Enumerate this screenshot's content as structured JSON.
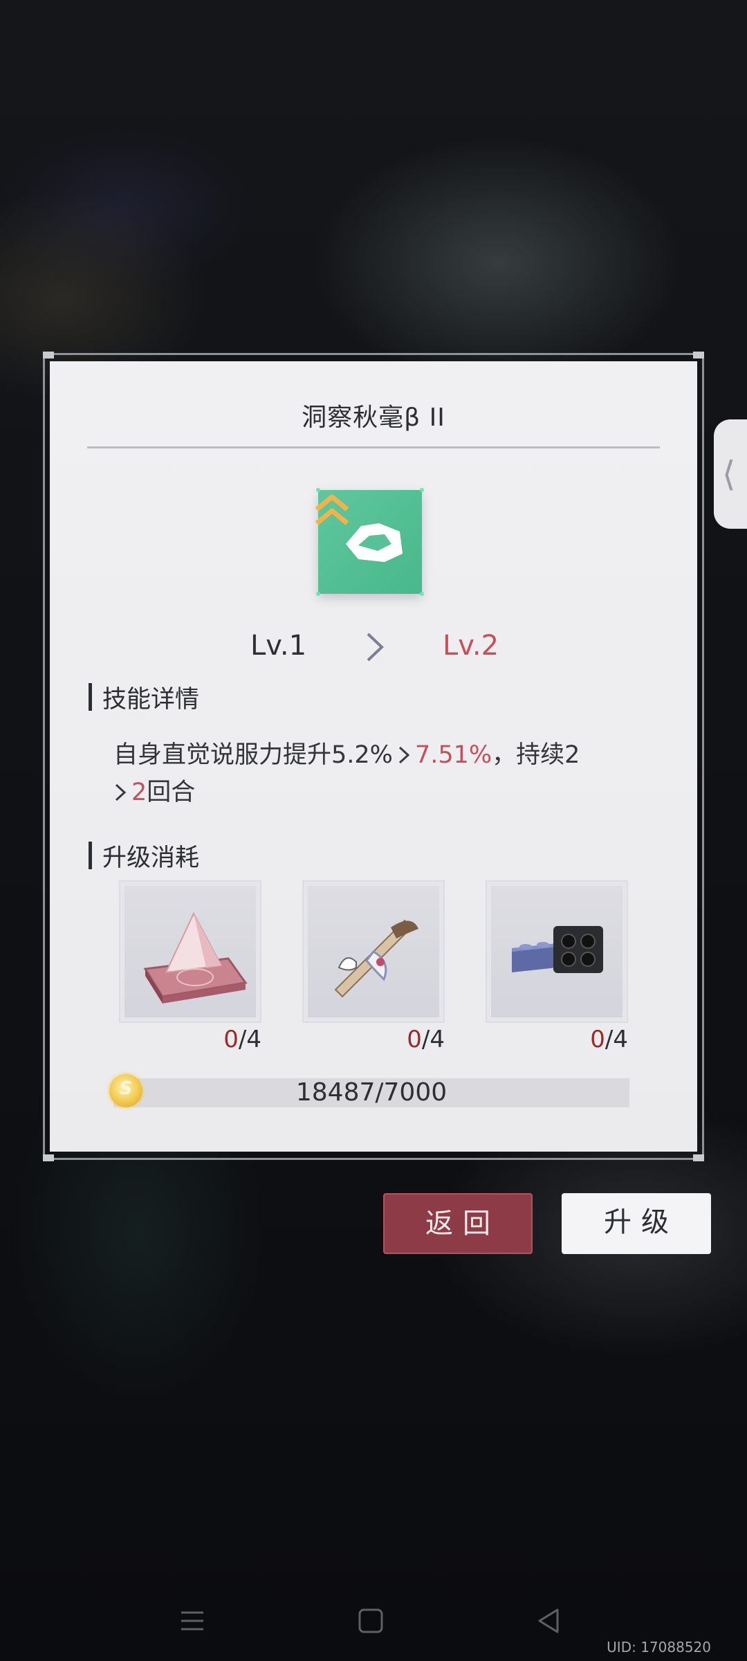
{
  "dialog": {
    "title": "洞察秋毫β II",
    "level": {
      "from": "Lv.1",
      "to": "Lv.2"
    },
    "skill_section": {
      "title": "技能详情",
      "desc": {
        "part1": "自身直觉说服力提升5.2%",
        "part2_new": "7.51%",
        "part3": "，持续2",
        "part4_new": "2",
        "part5": "回合"
      }
    },
    "cost_section": {
      "title": "升级消耗",
      "materials": [
        {
          "name": "pink-crystal-pyramid",
          "have": "0",
          "need": "/4"
        },
        {
          "name": "feather-quill-ribbon",
          "have": "0",
          "need": "/4"
        },
        {
          "name": "black-building-block",
          "have": "0",
          "need": "/4"
        }
      ],
      "coins": "18487/7000"
    }
  },
  "buttons": {
    "back": "返回",
    "upgrade": "升级"
  },
  "uid": "UID: 17088520",
  "colors": {
    "accent_red": "#c4505c",
    "button_back": "#8c3b47",
    "skill_icon": "#54c094"
  }
}
